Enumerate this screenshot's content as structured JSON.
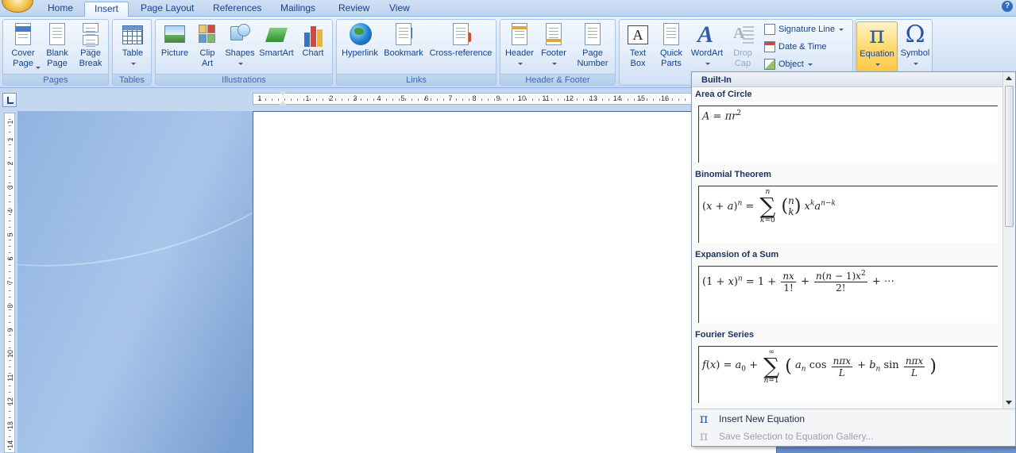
{
  "tabs": [
    {
      "label": "Home",
      "active": false
    },
    {
      "label": "Insert",
      "active": true
    },
    {
      "label": "Page Layout",
      "active": false
    },
    {
      "label": "References",
      "active": false
    },
    {
      "label": "Mailings",
      "active": false
    },
    {
      "label": "Review",
      "active": false
    },
    {
      "label": "View",
      "active": false
    }
  ],
  "help_label": "?",
  "ribbon": {
    "pages": {
      "label": "Pages",
      "cover_page": "Cover Page",
      "blank_page": "Blank Page",
      "page_break": "Page Break"
    },
    "tables": {
      "label": "Tables",
      "table": "Table"
    },
    "illustrations": {
      "label": "Illustrations",
      "picture": "Picture",
      "clip_art": "Clip Art",
      "shapes": "Shapes",
      "smartart": "SmartArt",
      "chart": "Chart"
    },
    "links": {
      "label": "Links",
      "hyperlink": "Hyperlink",
      "bookmark": "Bookmark",
      "cross_reference": "Cross-reference"
    },
    "header_footer": {
      "label": "Header & Footer",
      "header": "Header",
      "footer": "Footer",
      "page_number": "Page Number"
    },
    "text": {
      "text_box": "Text Box",
      "quick_parts": "Quick Parts",
      "wordart": "WordArt",
      "drop_cap": "Drop Cap",
      "signature_line": "Signature Line",
      "date_time": "Date & Time",
      "object": "Object"
    },
    "symbols": {
      "equation": "Equation",
      "symbol": "Symbol",
      "equation_glyph": "π",
      "symbol_glyph": "Ω"
    }
  },
  "ruler": {
    "h_numbers": [
      "1",
      "1",
      "2",
      "3",
      "4",
      "5",
      "6",
      "7",
      "8",
      "9",
      "10",
      "11",
      "12",
      "13",
      "14",
      "15",
      "16"
    ],
    "v_numbers": [
      "1",
      "1",
      "2",
      "3",
      "4",
      "5",
      "6",
      "7",
      "8",
      "9",
      "10",
      "11",
      "12",
      "13",
      "14"
    ]
  },
  "equation_menu": {
    "header": "Built-In",
    "items": [
      {
        "title": "Area of Circle"
      },
      {
        "title": "Binomial Theorem"
      },
      {
        "title": "Expansion of a Sum"
      },
      {
        "title": "Fourier Series"
      }
    ],
    "insert_new": "Insert New Equation",
    "save_selection": "Save Selection to Equation Gallery..."
  }
}
